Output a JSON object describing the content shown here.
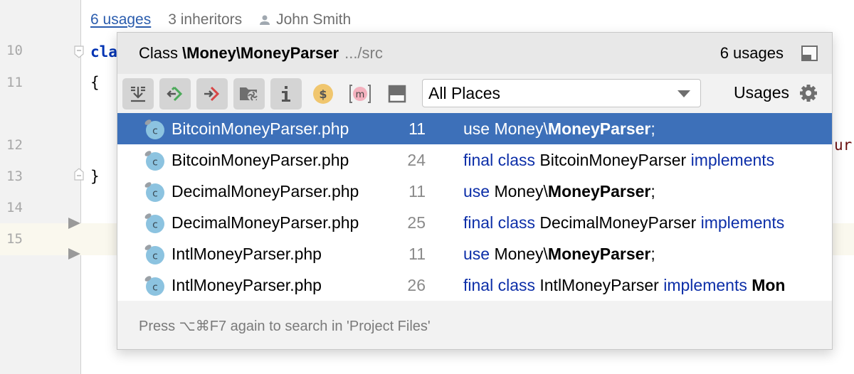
{
  "editor": {
    "line_numbers": [
      "10",
      "11",
      "12",
      "13",
      "14",
      "15"
    ],
    "code_class_fragment": "cla",
    "code_open_brace": "{",
    "code_close_brace": "}",
    "code_right_fragment": "ur",
    "inlay_hints": {
      "usages": "6 usages",
      "inheritors": "3 inheritors",
      "author": "John Smith"
    }
  },
  "popup": {
    "header": {
      "prefix": "Class",
      "class_path": "\\Money\\MoneyParser",
      "location": ".../src",
      "count": "6 usages",
      "pin_icon": "pin-window-icon"
    },
    "toolbar": {
      "buttons": [
        {
          "name": "merge-usages",
          "icon": "merge-down-icon",
          "active": true
        },
        {
          "name": "show-read-access",
          "icon": "read-access-icon",
          "active": true
        },
        {
          "name": "show-write-access",
          "icon": "write-access-icon",
          "active": true
        },
        {
          "name": "group-by-module",
          "icon": "folder-module-icon",
          "active": true
        },
        {
          "name": "show-info",
          "icon": "info-icon",
          "active": true
        },
        {
          "name": "filter-constants",
          "icon": "dollar-icon",
          "active": false
        },
        {
          "name": "filter-methods",
          "icon": "method-icon",
          "active": false
        },
        {
          "name": "preview",
          "icon": "preview-panel-icon",
          "active": false
        }
      ],
      "scope": "All Places",
      "usages_label": "Usages",
      "settings_icon": "gear-icon"
    },
    "results": [
      {
        "file": "BitcoinMoneyParser.php",
        "line": "11",
        "selected": true,
        "snippet": [
          {
            "t": "use ",
            "s": "k"
          },
          {
            "t": "Money\\",
            "s": ""
          },
          {
            "t": "MoneyParser",
            "s": "b"
          },
          {
            "t": ";",
            "s": ""
          }
        ]
      },
      {
        "file": "BitcoinMoneyParser.php",
        "line": "24",
        "selected": false,
        "snippet": [
          {
            "t": "final class ",
            "s": "k"
          },
          {
            "t": "BitcoinMoneyParser ",
            "s": ""
          },
          {
            "t": "implements",
            "s": "k"
          }
        ]
      },
      {
        "file": "DecimalMoneyParser.php",
        "line": "11",
        "selected": false,
        "snippet": [
          {
            "t": "use ",
            "s": "k"
          },
          {
            "t": "Money\\",
            "s": ""
          },
          {
            "t": "MoneyParser",
            "s": "b"
          },
          {
            "t": ";",
            "s": ""
          }
        ]
      },
      {
        "file": "DecimalMoneyParser.php",
        "line": "25",
        "selected": false,
        "snippet": [
          {
            "t": "final class ",
            "s": "k"
          },
          {
            "t": "DecimalMoneyParser ",
            "s": ""
          },
          {
            "t": "implements",
            "s": "k"
          }
        ]
      },
      {
        "file": "IntlMoneyParser.php",
        "line": "11",
        "selected": false,
        "snippet": [
          {
            "t": "use ",
            "s": "k"
          },
          {
            "t": "Money\\",
            "s": ""
          },
          {
            "t": "MoneyParser",
            "s": "b"
          },
          {
            "t": ";",
            "s": ""
          }
        ]
      },
      {
        "file": "IntlMoneyParser.php",
        "line": "26",
        "selected": false,
        "snippet": [
          {
            "t": "final class ",
            "s": "k"
          },
          {
            "t": "IntlMoneyParser ",
            "s": ""
          },
          {
            "t": "implements ",
            "s": "k"
          },
          {
            "t": "Mon",
            "s": "b"
          }
        ]
      }
    ],
    "footer_hint": "Press ⌥⌘F7 again to search in 'Project Files'"
  },
  "colors": {
    "selection": "#3d70b9",
    "keyword": "#0c2ea8",
    "link": "#2a5cad",
    "class_icon": "#8cc3e0"
  }
}
